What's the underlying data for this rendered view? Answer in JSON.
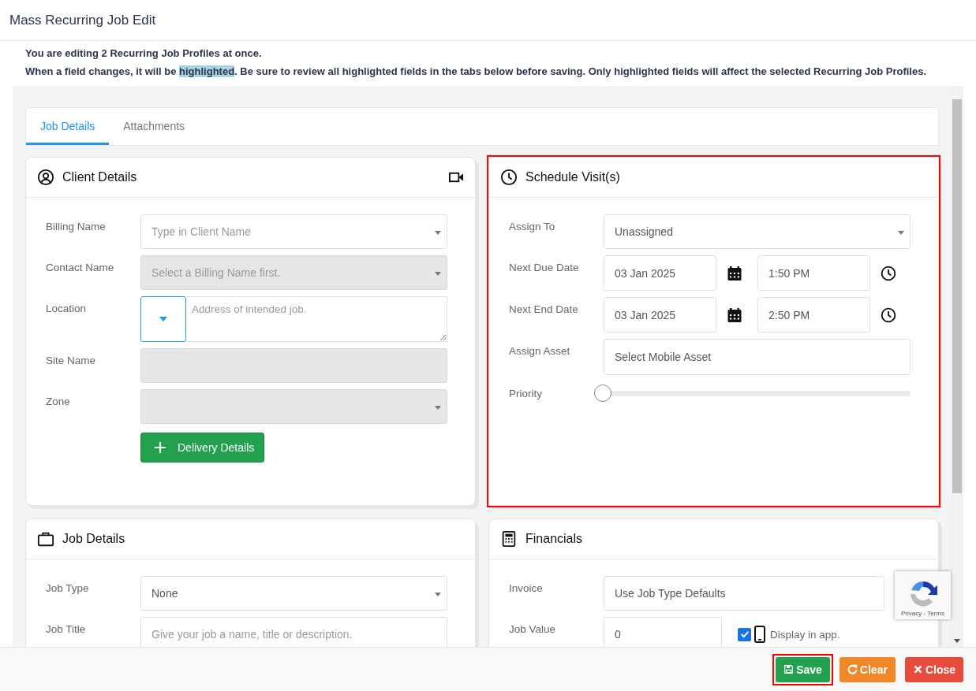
{
  "dialog": {
    "title": "Mass Recurring Job Edit"
  },
  "notice": {
    "line_1": "You are editing 2 Recurring Job Profiles at once.",
    "line_2_before": "When a field changes, it will be ",
    "line_2_highlight": "highlighted",
    "line_2_after": ". Be sure to review all highlighted fields in the tabs below before saving. Only highlighted fields will affect the selected Recurring Job Profiles."
  },
  "tabs": [
    {
      "label": "Job Details",
      "selected": true
    },
    {
      "label": "Attachments",
      "selected": false
    }
  ],
  "panels": [
    {
      "kind": "client",
      "title": "Client Details",
      "highlighted": false,
      "fields": [
        {
          "kind": "select",
          "label": "Billing Name",
          "placeholder": "Type in Client Name",
          "disabled": false
        },
        {
          "kind": "select",
          "label": "Contact Name",
          "placeholder": "Select a Billing Name first.",
          "disabled": true
        },
        {
          "kind": "location",
          "label": "Location",
          "placeholder": "Address of intended job."
        },
        {
          "kind": "input",
          "label": "Site Name",
          "disabled": true
        },
        {
          "kind": "select",
          "label": "Zone",
          "disabled": true
        },
        {
          "kind": "button",
          "text": "Delivery Details"
        }
      ]
    },
    {
      "kind": "schedule",
      "title": "Schedule Visit(s)",
      "highlighted": true,
      "fields": [
        {
          "kind": "select",
          "label": "Assign To",
          "value": "Unassigned",
          "disabled": false
        },
        {
          "kind": "datetime",
          "label": "Next Due Date",
          "date": "03 Jan 2025",
          "time": "1:50 PM"
        },
        {
          "kind": "datetime",
          "label": "Next End Date",
          "date": "03 Jan 2025",
          "time": "2:50 PM"
        },
        {
          "kind": "input",
          "label": "Assign Asset",
          "placeholder": "Select Mobile Asset",
          "disabled": false
        },
        {
          "kind": "slider",
          "label": "Priority",
          "level": 0
        }
      ]
    },
    {
      "kind": "job",
      "title": "Job Details",
      "highlighted": false,
      "fields": [
        {
          "kind": "select",
          "label": "Job Type",
          "value": "None",
          "disabled": false
        },
        {
          "kind": "input",
          "label": "Job Title",
          "placeholder": "Give your job a name, title or description.",
          "disabled": false
        }
      ]
    },
    {
      "kind": "financials",
      "title": "Financials",
      "highlighted": false,
      "fields": [
        {
          "kind": "input",
          "label": "Invoice",
          "value": "Use Job Type Defaults",
          "disabled": false
        },
        {
          "kind": "value-check",
          "label": "Job Value",
          "value": "0",
          "checked": true,
          "check_label": "Display in app."
        }
      ]
    }
  ],
  "recaptcha": {
    "links": "Privacy - Terms"
  },
  "footer_buttons": [
    {
      "kind": "save",
      "label": "Save",
      "highlighted": true
    },
    {
      "kind": "clear",
      "label": "Clear",
      "highlighted": false
    },
    {
      "kind": "close",
      "label": "Close",
      "highlighted": false
    }
  ]
}
